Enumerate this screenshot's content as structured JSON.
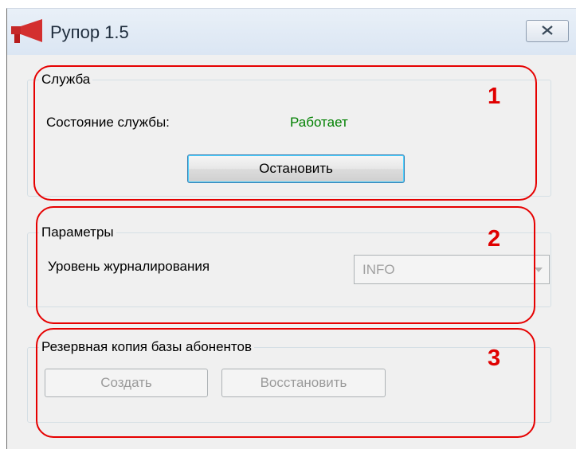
{
  "window": {
    "title": "Рупор 1.5"
  },
  "service_group": {
    "legend": "Служба",
    "status_label": "Состояние службы:",
    "status_value": "Работает",
    "stop_button": "Остановить"
  },
  "params_group": {
    "legend": "Параметры",
    "log_level_label": "Уровень журналирования",
    "log_level_value": "INFO"
  },
  "backup_group": {
    "legend": "Резервная копия базы абонентов",
    "create_button": "Создать",
    "restore_button": "Восстановить"
  },
  "annotations": [
    "1",
    "2",
    "3"
  ],
  "colors": {
    "annotation": "#e00000",
    "status_ok": "#008000"
  },
  "icons": {
    "app": "megaphone-icon",
    "close": "close-icon",
    "dropdown": "chevron-down-icon"
  }
}
